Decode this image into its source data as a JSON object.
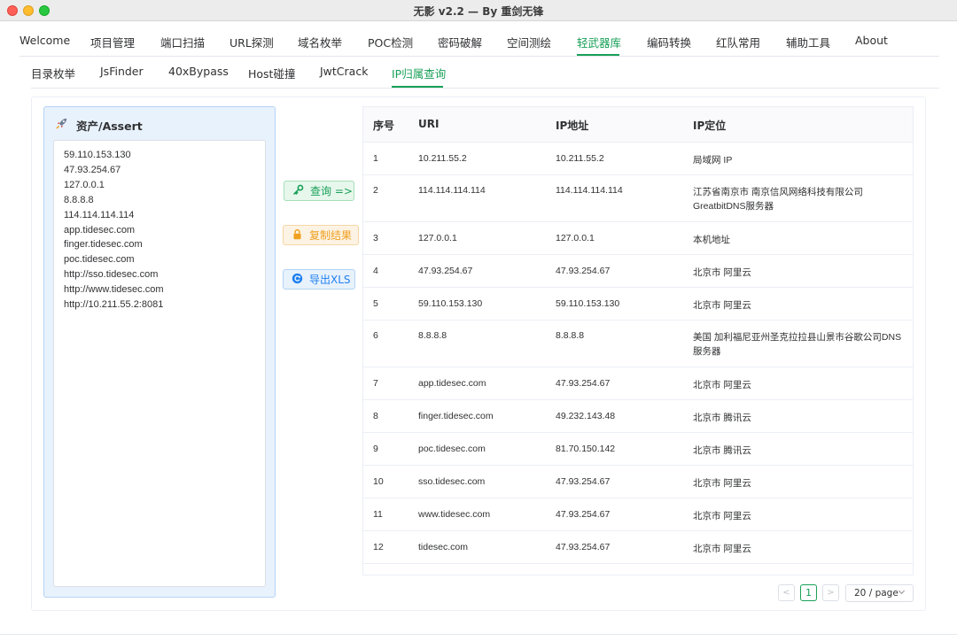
{
  "window": {
    "title": "无影 v2.2 — By 重剑无锋"
  },
  "main_tabs": [
    "Welcome",
    "项目管理",
    "端口扫描",
    "URL探测",
    "域名枚举",
    "POC检测",
    "密码破解",
    "空间测绘",
    "轻武器库",
    "编码转换",
    "红队常用",
    "辅助工具",
    "About"
  ],
  "main_tabs_active": "轻武器库",
  "sub_tabs": [
    "目录枚举",
    "JsFinder",
    "40xBypass",
    "Host碰撞",
    "JwtCrack",
    "IP归属查询"
  ],
  "sub_tabs_active": "IP归属查询",
  "asset_panel": {
    "title": "资产/Assert",
    "lines": [
      "59.110.153.130",
      "47.93.254.67",
      "127.0.0.1",
      "8.8.8.8",
      "114.114.114.114",
      "app.tidesec.com",
      "finger.tidesec.com",
      "poc.tidesec.com",
      "http://sso.tidesec.com",
      "http://www.tidesec.com",
      "http://10.211.55.2:8081"
    ]
  },
  "buttons": {
    "query": "查询 =>",
    "copy": "复制结果",
    "export": "导出XLS"
  },
  "table": {
    "headers": [
      "序号",
      "URI",
      "IP地址",
      "IP定位"
    ],
    "rows": [
      [
        "1",
        "10.211.55.2",
        "10.211.55.2",
        "局域网 IP"
      ],
      [
        "2",
        "114.114.114.114",
        "114.114.114.114",
        "江苏省南京市 南京信风网络科技有限公司GreatbitDNS服务器"
      ],
      [
        "3",
        "127.0.0.1",
        "127.0.0.1",
        "本机地址"
      ],
      [
        "4",
        "47.93.254.67",
        "47.93.254.67",
        "北京市 阿里云"
      ],
      [
        "5",
        "59.110.153.130",
        "59.110.153.130",
        "北京市 阿里云"
      ],
      [
        "6",
        "8.8.8.8",
        "8.8.8.8",
        "美国 加利福尼亚州圣克拉拉县山景市谷歌公司DNS服务器"
      ],
      [
        "7",
        "app.tidesec.com",
        "47.93.254.67",
        "北京市 阿里云"
      ],
      [
        "8",
        "finger.tidesec.com",
        "49.232.143.48",
        "北京市 腾讯云"
      ],
      [
        "9",
        "poc.tidesec.com",
        "81.70.150.142",
        "北京市 腾讯云"
      ],
      [
        "10",
        "sso.tidesec.com",
        "47.93.254.67",
        "北京市 阿里云"
      ],
      [
        "11",
        "www.tidesec.com",
        "47.93.254.67",
        "北京市 阿里云"
      ],
      [
        "12",
        "tidesec.com",
        "47.93.254.67",
        "北京市 阿里云"
      ]
    ]
  },
  "pagination": {
    "prev": "<",
    "current": "1",
    "next": ">",
    "page_size": "20 / page"
  },
  "icons": {
    "rocket": "rocket-icon",
    "key": "key-icon",
    "lock": "lock-icon",
    "refresh": "refresh-icon",
    "chevron": "chevron-down-icon"
  },
  "colors": {
    "accent": "#18a058",
    "warning": "#f0a020",
    "info": "#2080f0"
  }
}
